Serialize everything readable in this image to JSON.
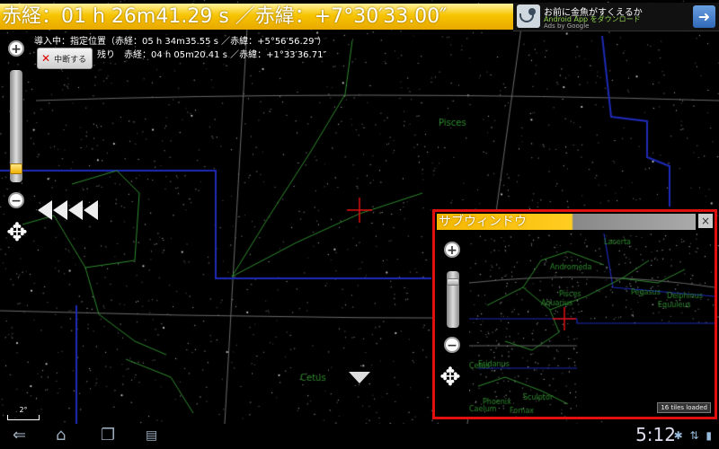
{
  "header": {
    "coordinate_readout": "赤経：01 h 26m41.29 s ／赤緯：+7°30′33.00″"
  },
  "ad": {
    "title": "お前に金魚がすくえるか",
    "subtitle": "Android App をダウンロード",
    "by": "Ads by Google",
    "icon": "satellite-dish-icon",
    "action_icon": "arrow-right-icon"
  },
  "guidance": {
    "line1": "導入中：指定位置（赤経：05 h 34m35.55 s ／赤緯：+5°56′56.29″）",
    "line2": "残り　赤経：04 h 05m20.41 s ／赤緯：+1°33′36.71″",
    "stop_label": "中断する"
  },
  "map": {
    "scale_label": "2°",
    "constellation_labels": [
      "Pisces",
      "Cetus"
    ]
  },
  "subwindow": {
    "title": "サブウィンドウ",
    "close_label": "×",
    "tiles_status": "16 tiles loaded",
    "zoom_level": 0.85,
    "constellation_labels": [
      "Lacerta",
      "Andromeda",
      "Pegasus",
      "Delphinus",
      "Equuleus",
      "Pisces",
      "Aquarius",
      "Cetus",
      "Eridanus",
      "Fornax",
      "Sculptor",
      "Phoenix",
      "Caelum"
    ]
  },
  "main_zoom_level": 0.08,
  "system_bar": {
    "time": "5:12",
    "icons": [
      "back-icon",
      "home-icon",
      "recent-apps-icon",
      "menu-icon"
    ]
  },
  "colors": {
    "accent": "#f7c400",
    "crosshair": "#e01010",
    "constellation_line": "#2e8b2e",
    "boundary": "#1e2bb8"
  }
}
